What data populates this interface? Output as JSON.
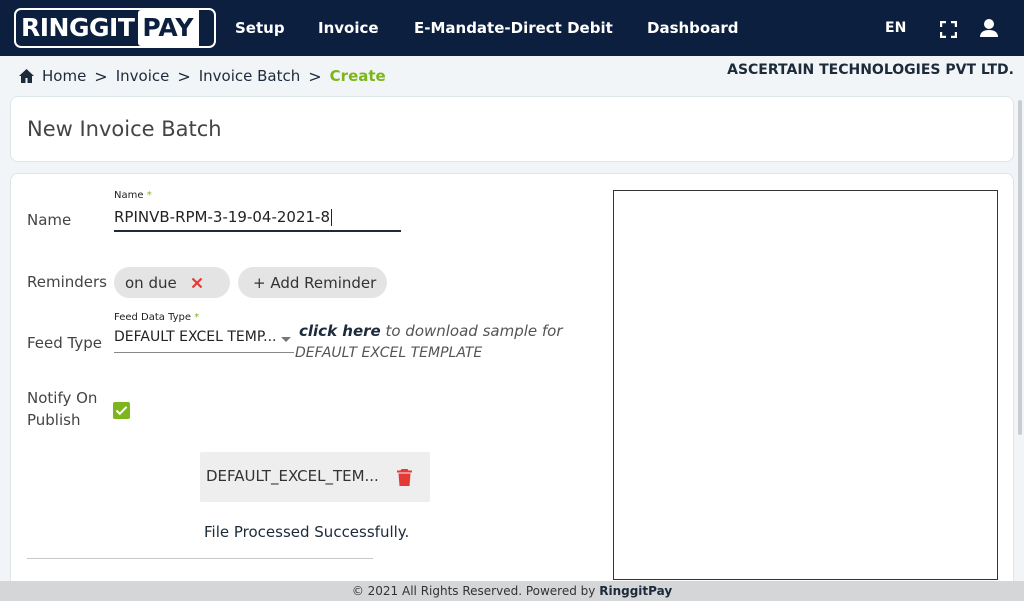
{
  "app": {
    "logo_left": "RINGGIT",
    "logo_right": "PAY",
    "nav": [
      "Setup",
      "Invoice",
      "E-Mandate-Direct Debit",
      "Dashboard"
    ],
    "language": "EN",
    "icons": {
      "fullscreen": "fullscreen-icon",
      "user": "user-icon",
      "home": "home-icon"
    }
  },
  "breadcrumb": {
    "items": [
      "Home",
      "Invoice",
      "Invoice Batch"
    ],
    "current": "Create",
    "separator": ">"
  },
  "company": "ASCERTAIN TECHNOLOGIES PVT LTD.",
  "page": {
    "title": "New Invoice Batch"
  },
  "form": {
    "name": {
      "row_label": "Name",
      "field_label": "Name",
      "required_mark": "*",
      "value": "RPINVB-RPM-3-19-04-2021-8"
    },
    "reminders": {
      "row_label": "Reminders",
      "chips": [
        "on due"
      ],
      "add_label": "+ Add Reminder"
    },
    "feed_type": {
      "row_label": "Feed Type",
      "field_label": "Feed Data Type",
      "required_mark": "*",
      "selected": "DEFAULT EXCEL TEMP...",
      "download_link": "click here",
      "download_text": "to download sample for",
      "download_template": "DEFAULT EXCEL TEMPLATE"
    },
    "notify": {
      "row_label_1": "Notify On",
      "row_label_2": "Publish",
      "checked": true
    },
    "file": {
      "name": "DEFAULT_EXCEL_TEM...",
      "status": "File Processed Successfully."
    }
  },
  "footer": {
    "text": "© 2021 All Rights Reserved. Powered by",
    "brand": "RinggitPay"
  },
  "colors": {
    "nav_bg": "#0d1f3f",
    "accent": "#7cb51c",
    "delete": "#e53935"
  }
}
